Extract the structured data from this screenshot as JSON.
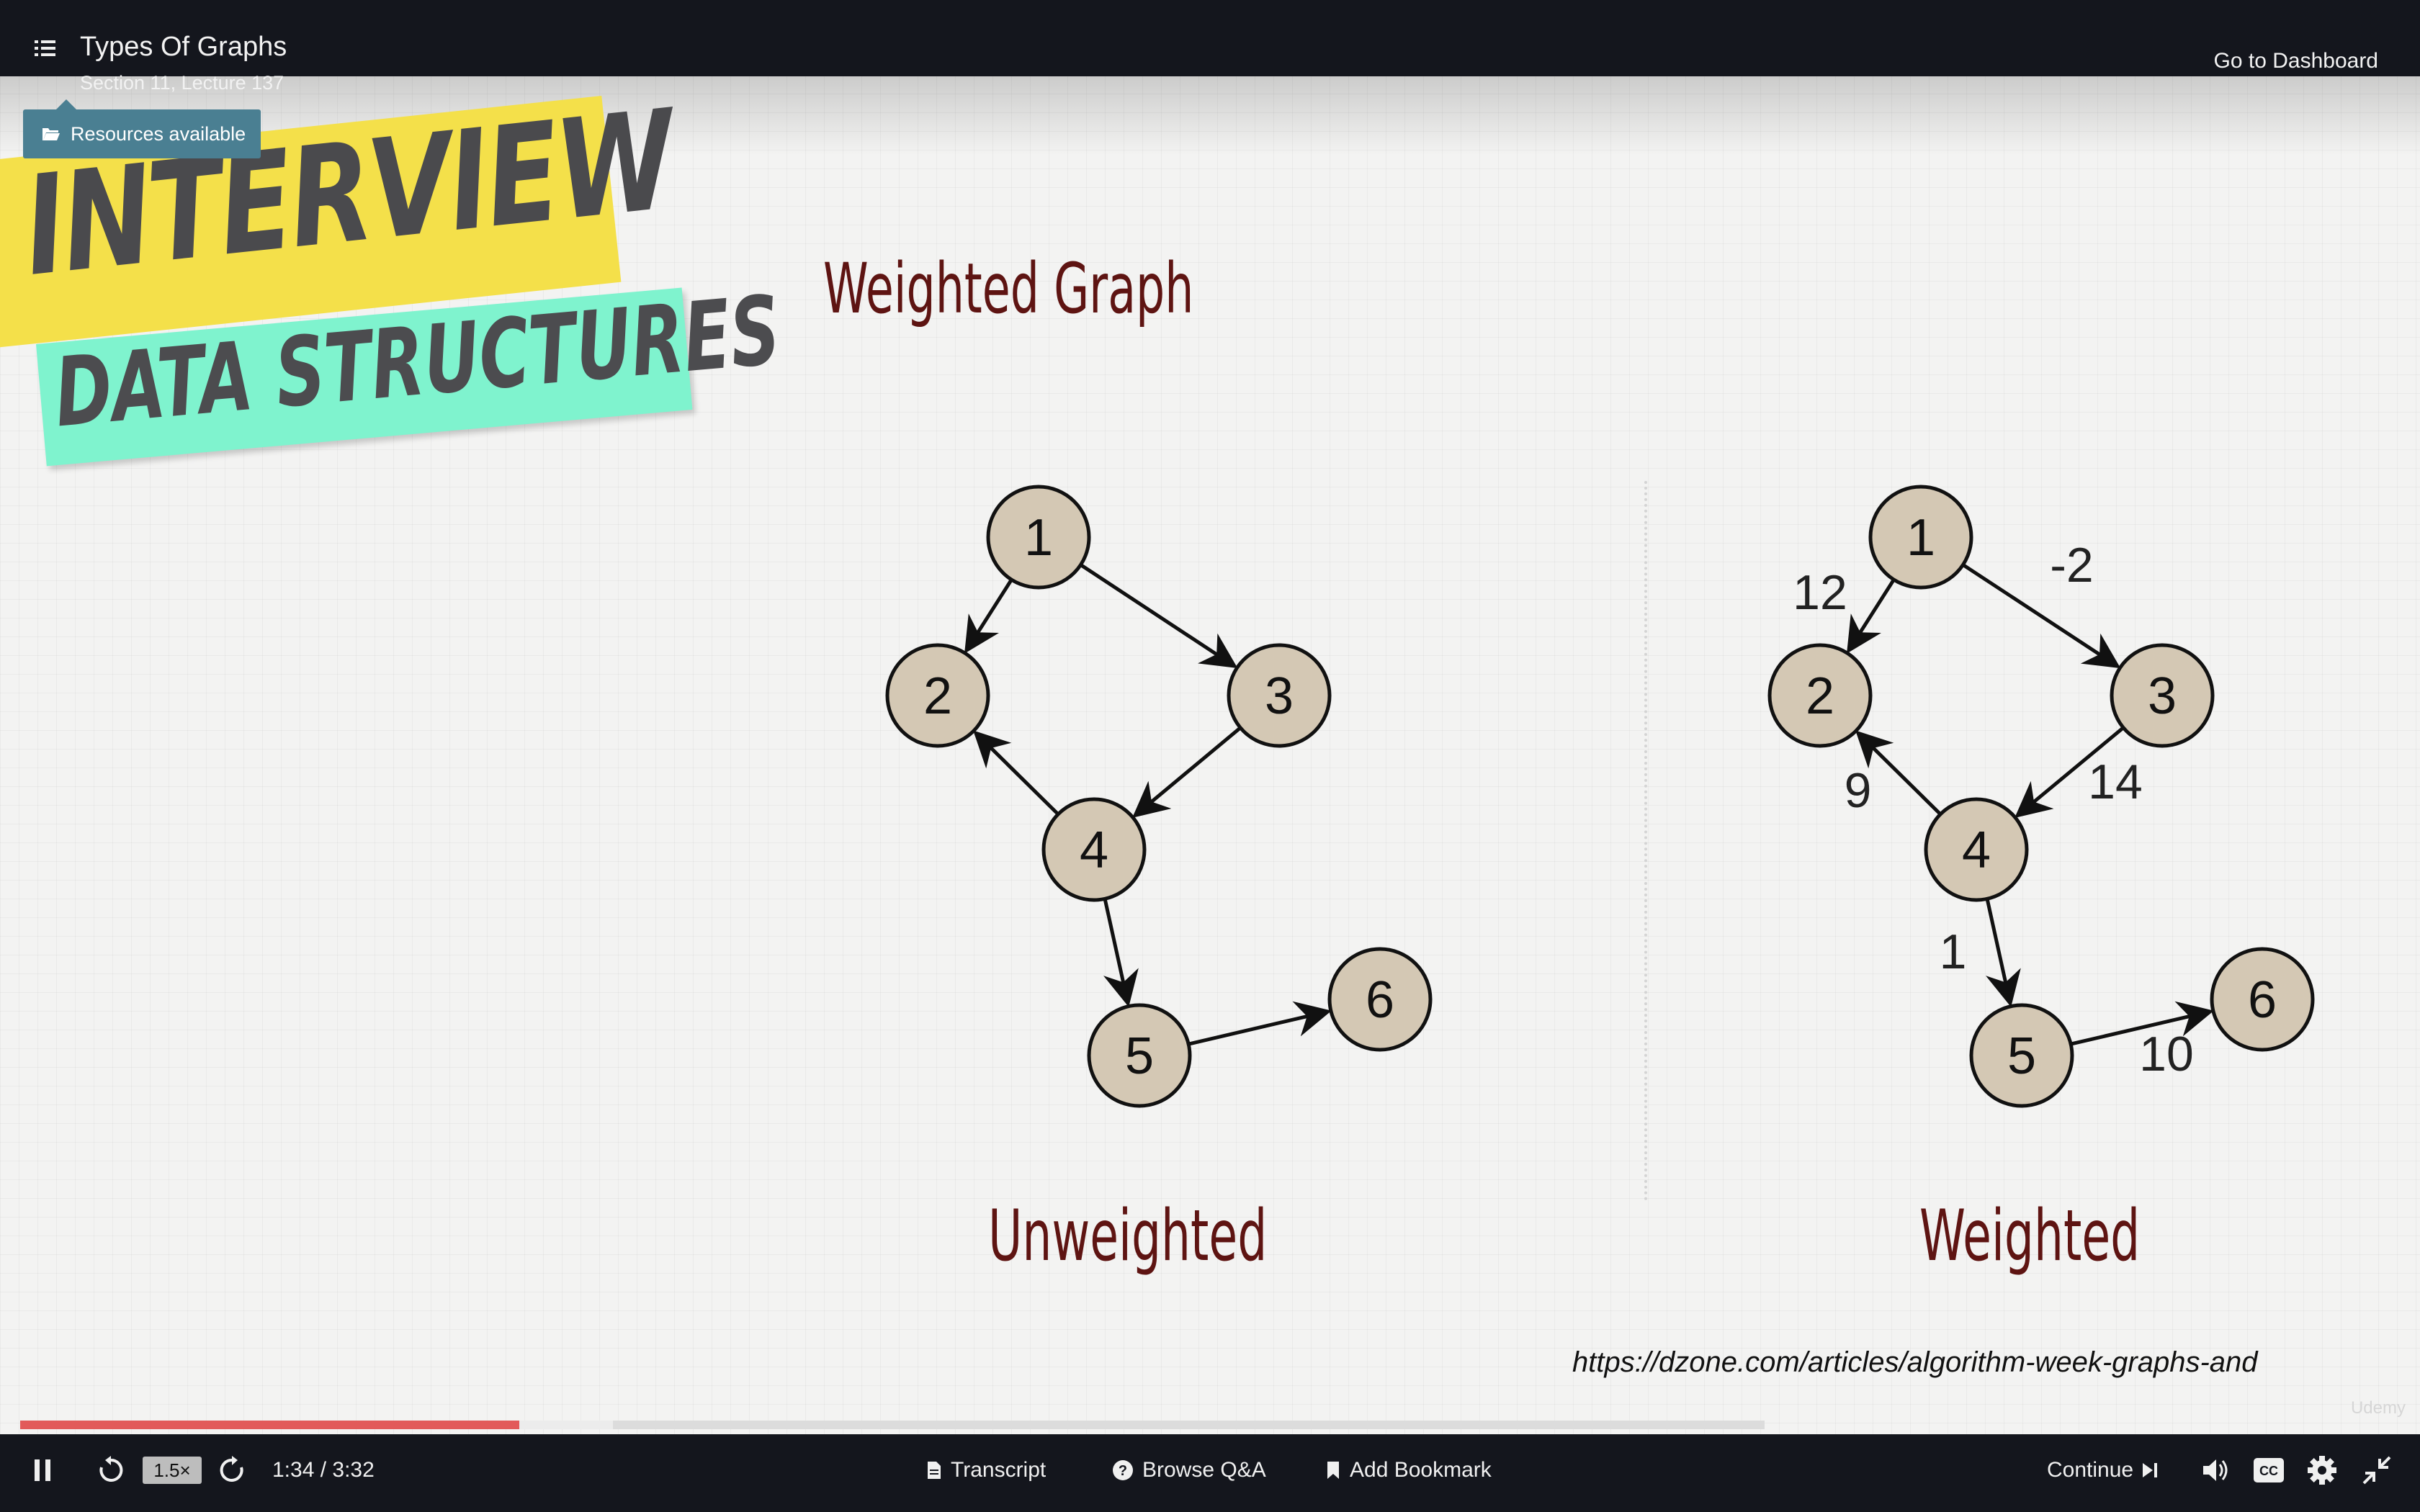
{
  "header": {
    "lecture_title": "Types Of Graphs",
    "lecture_subtitle": "Section 11, Lecture 137",
    "dashboard_link": "Go to Dashboard",
    "resources_label": "Resources available"
  },
  "banner": {
    "line1": "INTERVIEW",
    "line2": "DATA STRUCTURES",
    "colors": {
      "yellow": "#f4e04a",
      "teal": "#7ff3ce",
      "text": "#4a4a4d"
    }
  },
  "slide": {
    "heading": "Weighted Graph",
    "caption_left": "Unweighted",
    "caption_right": "Weighted",
    "source_url": "https://dzone.com/articles/algorithm-week-graphs-and",
    "watermark": "Udemy",
    "heading_color": "#5e1412",
    "node_fill": "#d4c8b4",
    "unweighted_graph": {
      "nodes": [
        "1",
        "2",
        "3",
        "4",
        "5",
        "6"
      ],
      "edges": [
        {
          "from": "1",
          "to": "2"
        },
        {
          "from": "1",
          "to": "3"
        },
        {
          "from": "3",
          "to": "4"
        },
        {
          "from": "4",
          "to": "2"
        },
        {
          "from": "4",
          "to": "5"
        },
        {
          "from": "5",
          "to": "6"
        }
      ]
    },
    "weighted_graph": {
      "nodes": [
        "1",
        "2",
        "3",
        "4",
        "5",
        "6"
      ],
      "edges": [
        {
          "from": "1",
          "to": "2",
          "weight": "12"
        },
        {
          "from": "1",
          "to": "3",
          "weight": "-2"
        },
        {
          "from": "3",
          "to": "4",
          "weight": "14"
        },
        {
          "from": "4",
          "to": "2",
          "weight": "9"
        },
        {
          "from": "4",
          "to": "5",
          "weight": "1"
        },
        {
          "from": "5",
          "to": "6",
          "weight": "10"
        }
      ]
    }
  },
  "player": {
    "time": "1:34 / 3:32",
    "speed": "1.5×",
    "progress": 0.286,
    "buffered": 0.34,
    "transcript_label": "Transcript",
    "qa_label": "Browse Q&A",
    "bookmark_label": "Add Bookmark",
    "continue_label": "Continue",
    "progress_color": "#e25a5a"
  }
}
